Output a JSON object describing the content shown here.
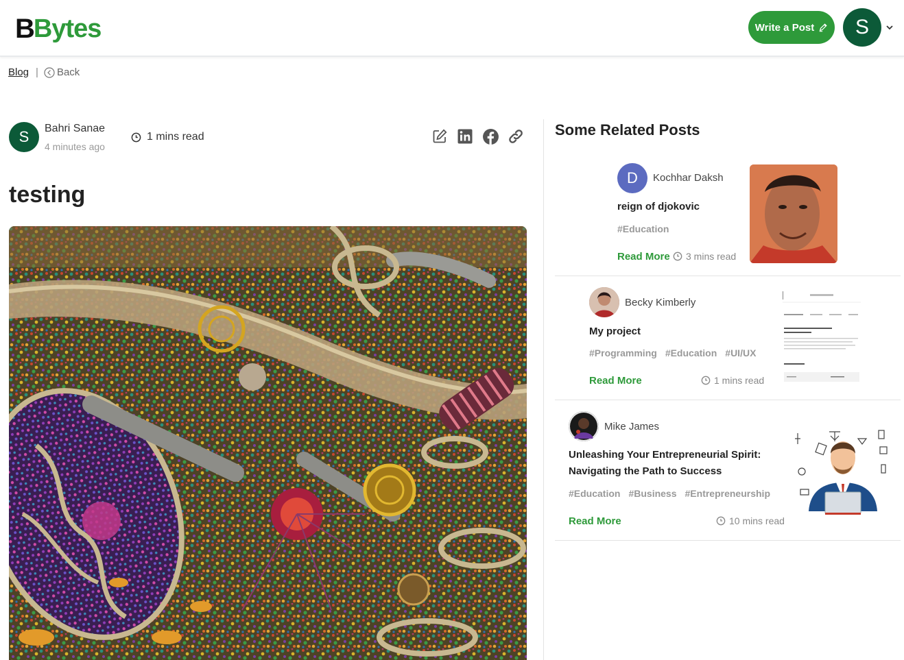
{
  "header": {
    "logo_b": "B",
    "logo_text": "Bytes",
    "write_post_label": "Write a Post",
    "user_initial": "S"
  },
  "breadcrumb": {
    "blog": "Blog",
    "separator": "|",
    "back": "Back"
  },
  "post": {
    "author_initial": "S",
    "author_name": "Bahri Sanae",
    "posted_ago": "4 minutes ago",
    "read_time": "1 mins read",
    "title": "testing",
    "share_icons": [
      "edit-icon",
      "linkedin-icon",
      "facebook-icon",
      "link-icon"
    ]
  },
  "related": {
    "heading": "Some Related Posts",
    "cards": [
      {
        "author": "Kochhar Daksh",
        "author_initial": "D",
        "title": "reign of djokovic",
        "tags": [
          "#Education"
        ],
        "read_more": "Read More",
        "mins": "3 mins read"
      },
      {
        "author": "Becky Kimberly",
        "title": "My project",
        "tags": [
          "#Programming",
          "#Education",
          "#UI/UX"
        ],
        "read_more": "Read More",
        "mins": "1 mins read"
      },
      {
        "author": "Mike James",
        "title": "Unleashing Your Entrepreneurial Spirit: Navigating the Path to Success",
        "tags": [
          "#Education",
          "#Business",
          "#Entrepreneurship"
        ],
        "read_more": "Read More",
        "mins": "10 mins read"
      }
    ]
  },
  "colors": {
    "brand_green": "#2e9a3a",
    "avatar_dark_green": "#0c5a38",
    "avatar_purple": "#5c6bc0"
  }
}
